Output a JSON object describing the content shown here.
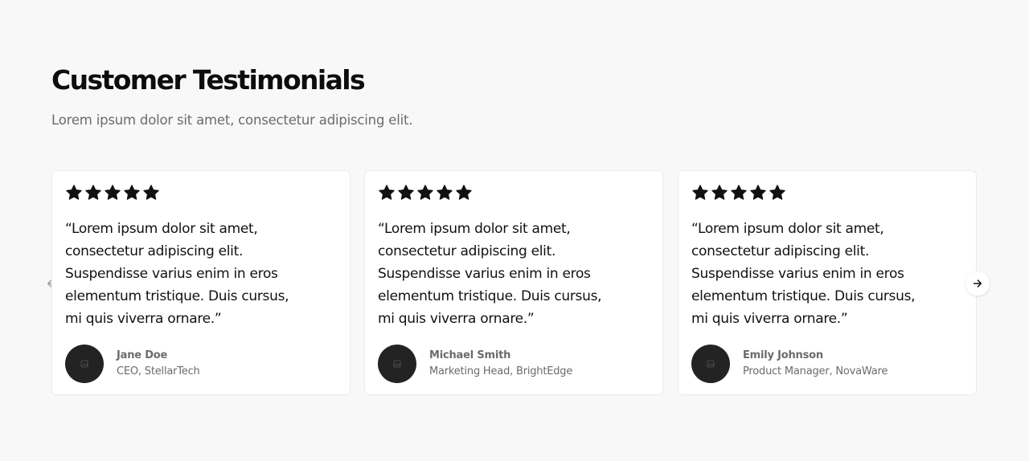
{
  "section": {
    "title": "Customer Testimonials",
    "subtitle": "Lorem ipsum dolor sit amet, consectetur adipiscing elit."
  },
  "carousel": {
    "prev_icon": "arrow-left-icon",
    "next_icon": "arrow-right-icon",
    "cards": [
      {
        "rating": 5,
        "quote": "“Lorem ipsum dolor sit amet, consectetur adipiscing elit. Suspendisse varius enim in eros elementum tristique. Duis cursus, mi quis viverra ornare.”",
        "name": "Jane Doe",
        "role": "CEO, StellarTech",
        "avatar_icon": "image-placeholder-icon"
      },
      {
        "rating": 5,
        "quote": "“Lorem ipsum dolor sit amet, consectetur adipiscing elit. Suspendisse varius enim in eros elementum tristique. Duis cursus, mi quis viverra ornare.”",
        "name": "Michael Smith",
        "role": "Marketing Head, BrightEdge",
        "avatar_icon": "image-placeholder-icon"
      },
      {
        "rating": 5,
        "quote": "“Lorem ipsum dolor sit amet, consectetur adipiscing elit. Suspendisse varius enim in eros elementum tristique. Duis cursus, mi quis viverra ornare.”",
        "name": "Emily Johnson",
        "role": "Product Manager, NovaWare",
        "avatar_icon": "image-placeholder-icon"
      }
    ]
  },
  "colors": {
    "background": "#f8f8f9",
    "card_background": "#ffffff",
    "text": "#111111",
    "muted_text": "#6b6b6b",
    "avatar": "#232323"
  }
}
